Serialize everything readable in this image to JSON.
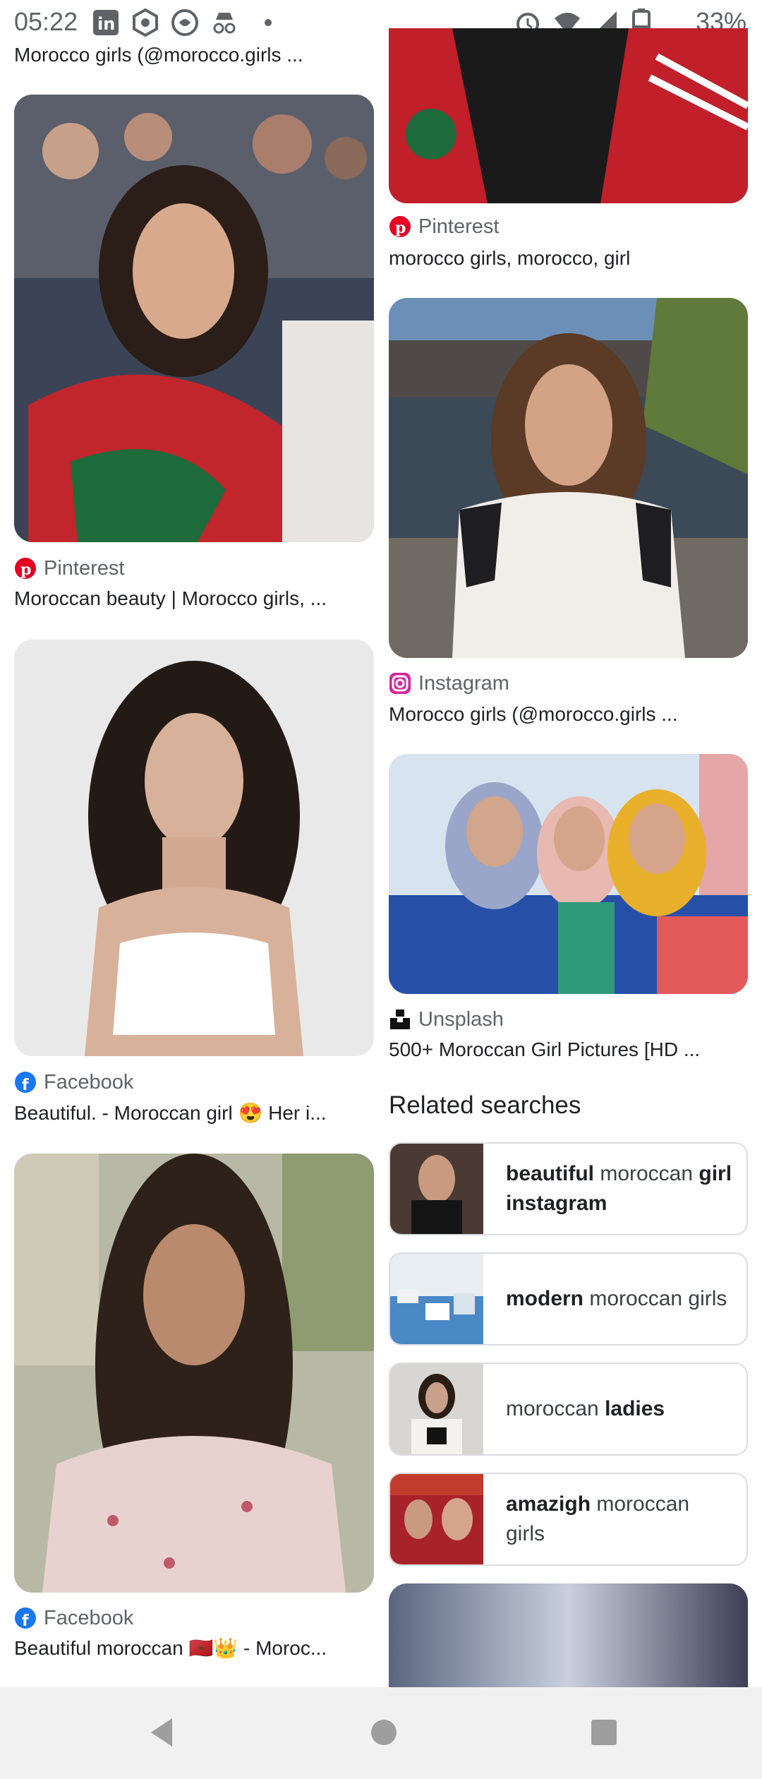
{
  "status_bar": {
    "time": "05:22",
    "battery": "33%",
    "icons_left": [
      "linkedin-icon",
      "crypto-icon",
      "messaging-icon",
      "incognito-icon",
      "dot-icon"
    ],
    "icons_right": [
      "alarm-icon",
      "wifi-icon",
      "signal-icon",
      "battery-icon"
    ]
  },
  "left_column": {
    "top_cutoff_title": "Morocco girls (@morocco.girls ...",
    "results": [
      {
        "source": "Pinterest",
        "title": "Moroccan beauty | Morocco girls, ...",
        "source_icon": "pinterest-icon"
      },
      {
        "source": "Facebook",
        "title": "Beautiful. - Moroccan girl 😍 Her i...",
        "source_icon": "facebook-icon"
      },
      {
        "source": "Facebook",
        "title": "Beautiful moroccan 🇲🇦👑 - Moroc...",
        "source_icon": "facebook-icon"
      }
    ]
  },
  "right_column": {
    "results": [
      {
        "source": "Pinterest",
        "title": "morocco girls, morocco, girl",
        "source_icon": "pinterest-icon"
      },
      {
        "source": "Instagram",
        "title": "Morocco girls (@morocco.girls ...",
        "source_icon": "instagram-icon"
      },
      {
        "source": "Unsplash",
        "title": "500+ Moroccan Girl Pictures [HD ...",
        "source_icon": "unsplash-icon"
      }
    ]
  },
  "related": {
    "heading": "Related searches",
    "items": [
      {
        "bold1": "beautiful",
        "normal1": " moroccan ",
        "bold2": "girl instagram",
        "normal2": ""
      },
      {
        "bold1": "modern",
        "normal1": " moroccan girls",
        "bold2": "",
        "normal2": ""
      },
      {
        "bold1": "",
        "normal1": "moroccan ",
        "bold2": "ladies",
        "normal2": ""
      },
      {
        "bold1": "amazigh",
        "normal1": " moroccan girls",
        "bold2": "",
        "normal2": ""
      }
    ]
  },
  "nav": {
    "buttons": [
      "back",
      "home",
      "recents"
    ]
  },
  "colors": {
    "accent_pinterest": "#e60023",
    "accent_facebook": "#1877f2",
    "nav_bg": "#f1f1f1"
  }
}
